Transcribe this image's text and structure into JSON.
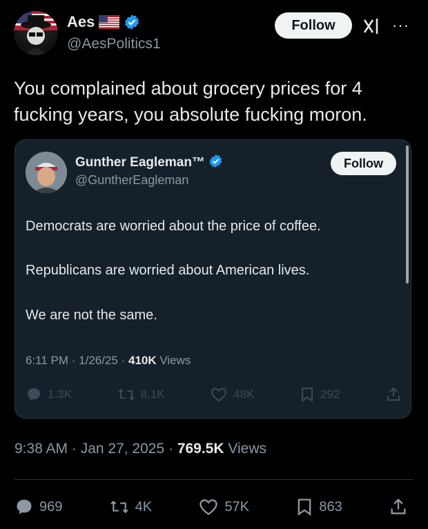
{
  "author": {
    "name": "Aes",
    "handle": "@AesPolitics1",
    "follow_label": "Follow"
  },
  "tweet_text": "You complained about grocery prices for 4 fucking years, you absolute fucking moron.",
  "quoted": {
    "name": "Gunther Eagleman™",
    "handle": "@GuntherEagleman",
    "follow_label": "Follow",
    "lines": [
      "Democrats are worried about the price of coffee.",
      "Republicans are worried about American lives.",
      "We are not the same."
    ],
    "time": "6:11 PM · 1/26/25 · ",
    "views_count": "410K",
    "views_label": "Views",
    "replies": "1.3K",
    "reposts": "8.1K",
    "likes": "48K",
    "bookmarks": "292"
  },
  "meta": {
    "time": "9:38 AM · Jan 27, 2025 · ",
    "views_count": "769.5K",
    "views_label": "Views"
  },
  "stats": {
    "replies": "969",
    "reposts": "4K",
    "likes": "57K",
    "bookmarks": "863"
  },
  "colors": {
    "background": "#000000",
    "card": "#15202b",
    "verified": "#1d9bf0",
    "secondary_text": "#8b98a5"
  },
  "icons": [
    "verified-badge-icon",
    "us-flag-icon",
    "grok-icon",
    "more-icon",
    "reply-icon",
    "repost-icon",
    "like-icon",
    "bookmark-icon",
    "share-icon"
  ]
}
